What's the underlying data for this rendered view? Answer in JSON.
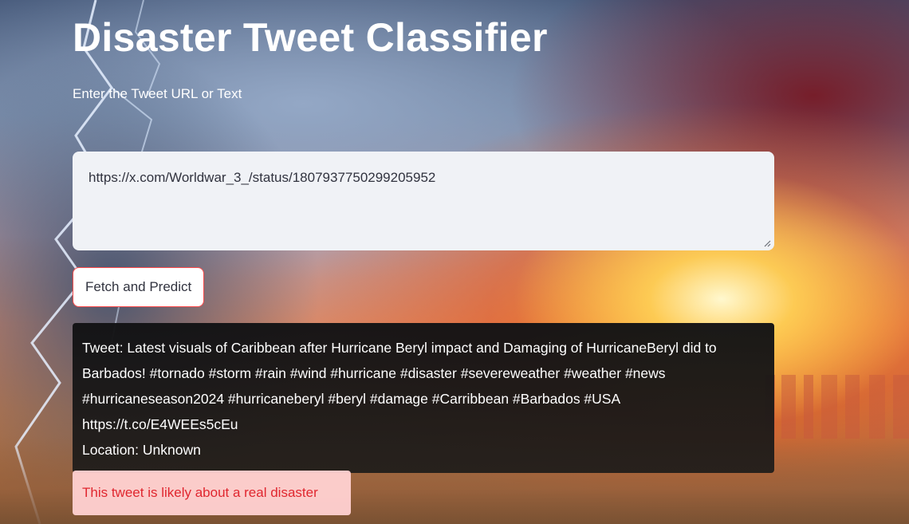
{
  "app": {
    "title": "Disaster Tweet Classifier"
  },
  "input": {
    "label": "Enter the Tweet URL or Text",
    "value": "https://x.com/Worldwar_3_/status/1807937750299205952"
  },
  "actions": {
    "predict_label": "Fetch and Predict"
  },
  "result": {
    "tweet_text": "Tweet: Latest visuals of Caribbean after Hurricane Beryl impact and Damaging of HurricaneBeryl did to Barbados! #tornado #storm #rain #wind #hurricane #disaster #severeweather #weather #news #hurricaneseason2024 #hurricaneberyl #beryl #damage #Carribbean #Barbados #USA https://t.co/E4WEEs5cEu",
    "location": "Location: Unknown"
  },
  "prediction": {
    "message": "This tweet is likely about a real disaster"
  },
  "colors": {
    "accent": "#ff4b4b",
    "input_bg": "#f0f2f6",
    "error_bg": "#ffd0d0",
    "error_text": "#e0262f",
    "result_bg": "#121214"
  },
  "icons": {
    "resize": "resize-handle-icon"
  }
}
